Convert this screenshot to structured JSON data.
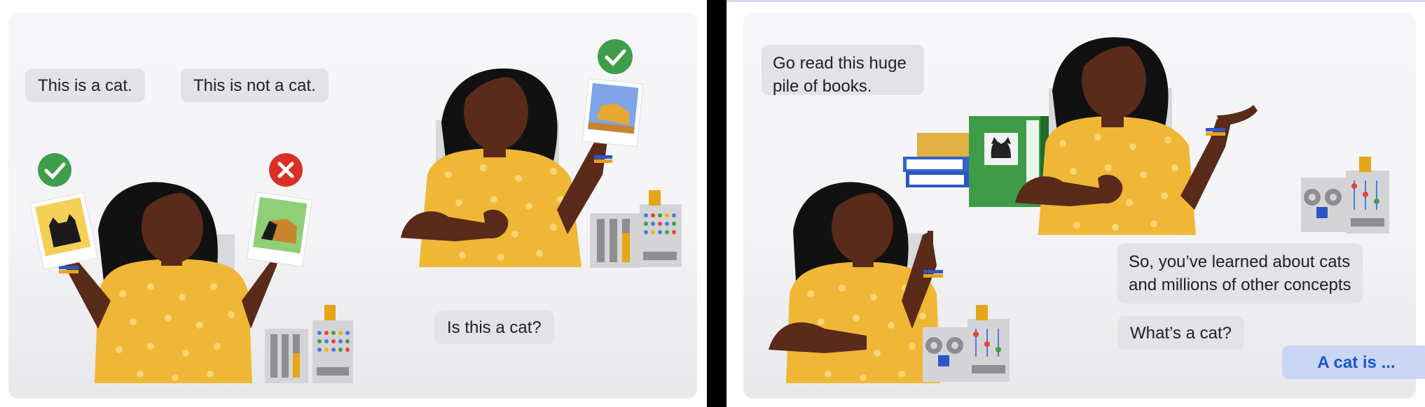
{
  "left_scene": {
    "bubble_cat": "This is a cat.",
    "bubble_not_cat": "This is not a cat.",
    "bubble_question": "Is this a cat?"
  },
  "right_scene": {
    "bubble_books": "Go read this huge\npile of books.",
    "bubble_learned": "So, you’ve learned about cats\nand millions of other concepts",
    "bubble_whats_cat": "What’s a cat?",
    "bubble_answer": "A cat is ..."
  },
  "colors": {
    "check_green": "#3f9e4c",
    "cross_red": "#d93025",
    "shirt_yellow": "#efb735",
    "answer_blue": "#1a56c9",
    "book_green": "#3e9c47"
  }
}
